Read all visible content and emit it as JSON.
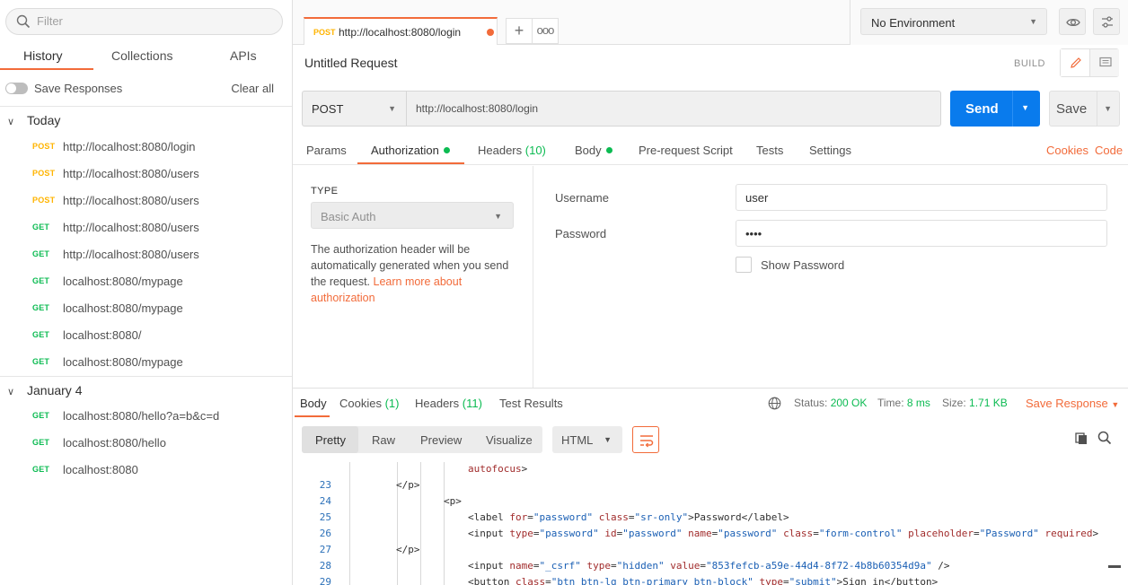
{
  "sidebar": {
    "filter_placeholder": "Filter",
    "tabs": [
      "History",
      "Collections",
      "APIs"
    ],
    "save_responses_label": "Save Responses",
    "clear_all_label": "Clear all",
    "groups": [
      {
        "label": "Today",
        "items": [
          {
            "method": "POST",
            "url": "http://localhost:8080/login"
          },
          {
            "method": "POST",
            "url": "http://localhost:8080/users"
          },
          {
            "method": "POST",
            "url": "http://localhost:8080/users"
          },
          {
            "method": "GET",
            "url": "http://localhost:8080/users"
          },
          {
            "method": "GET",
            "url": "http://localhost:8080/users"
          },
          {
            "method": "GET",
            "url": "localhost:8080/mypage"
          },
          {
            "method": "GET",
            "url": "localhost:8080/mypage"
          },
          {
            "method": "GET",
            "url": "localhost:8080/"
          },
          {
            "method": "GET",
            "url": "localhost:8080/mypage"
          }
        ]
      },
      {
        "label": "January 4",
        "items": [
          {
            "method": "GET",
            "url": "localhost:8080/hello?a=b&c=d"
          },
          {
            "method": "GET",
            "url": "localhost:8080/hello"
          },
          {
            "method": "GET",
            "url": "localhost:8080"
          }
        ]
      }
    ]
  },
  "tabbar": {
    "active_tab": {
      "method": "POST",
      "url": "http://localhost:8080/login"
    },
    "add_label": "+",
    "more_label": "ooo"
  },
  "environment": {
    "selected": "No Environment"
  },
  "request": {
    "title": "Untitled Request",
    "mode_label": "BUILD",
    "method": "POST",
    "url": "http://localhost:8080/login",
    "send_label": "Send",
    "save_label": "Save",
    "tabs": {
      "params": "Params",
      "authorization": "Authorization",
      "headers": "Headers",
      "headers_count": "(10)",
      "body": "Body",
      "prerequest": "Pre-request Script",
      "tests": "Tests",
      "settings": "Settings"
    },
    "links": {
      "cookies": "Cookies",
      "code": "Code"
    }
  },
  "auth": {
    "type_label": "TYPE",
    "type_value": "Basic Auth",
    "description": "The authorization header will be automatically generated when you send the request. ",
    "learn_more": "Learn more about authorization",
    "username_label": "Username",
    "username_value": "user",
    "password_label": "Password",
    "password_value": "••••",
    "show_password_label": "Show Password"
  },
  "response": {
    "tabs": {
      "body": "Body",
      "cookies": "Cookies",
      "cookies_count": "(1)",
      "headers": "Headers",
      "headers_count": "(11)",
      "test_results": "Test Results"
    },
    "status_label": "Status:",
    "status_value": "200 OK",
    "time_label": "Time:",
    "time_value": "8 ms",
    "size_label": "Size:",
    "size_value": "1.71 KB",
    "save_response_label": "Save Response",
    "view_options": [
      "Pretty",
      "Raw",
      "Preview",
      "Visualize"
    ],
    "format": "HTML"
  },
  "colors": {
    "accent": "#f26b3a",
    "send_blue": "#097bed",
    "post": "#ffb400",
    "get": "#0cbb52",
    "status_green": "#0cbb52"
  }
}
